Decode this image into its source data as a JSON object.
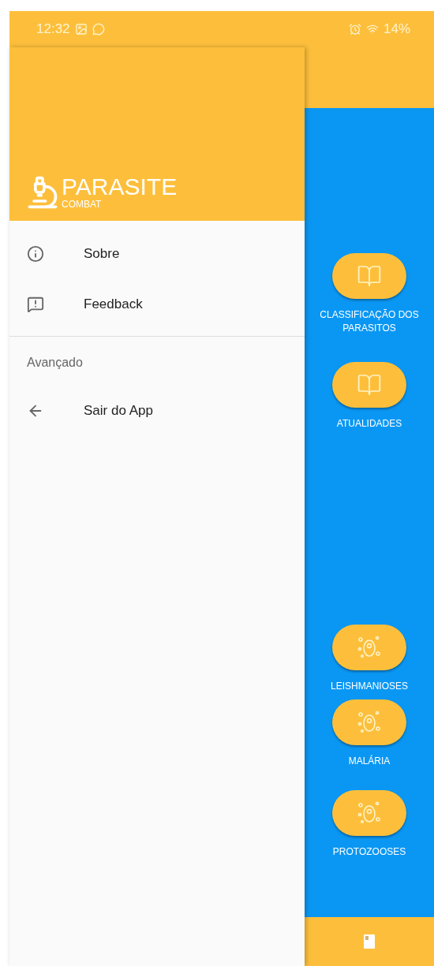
{
  "status_bar": {
    "time": "12:32",
    "battery": "14%"
  },
  "drawer": {
    "logo_title": "PARASITE",
    "logo_subtitle": "COMBAT",
    "items": [
      {
        "label": "Sobre"
      },
      {
        "label": "Feedback"
      }
    ],
    "section_title": "Avançado",
    "section_items": [
      {
        "label": "Sair do App"
      }
    ]
  },
  "main": {
    "top_buttons": [
      {
        "label": "CLASSIFICAÇÃO DOS PARASITOS"
      },
      {
        "label": "ATUALIDADES"
      }
    ],
    "bottom_buttons": [
      {
        "label": "LEISHMANIOSES"
      },
      {
        "label": "MALÁRIA"
      },
      {
        "label": "PROTOZOOSES"
      }
    ]
  }
}
